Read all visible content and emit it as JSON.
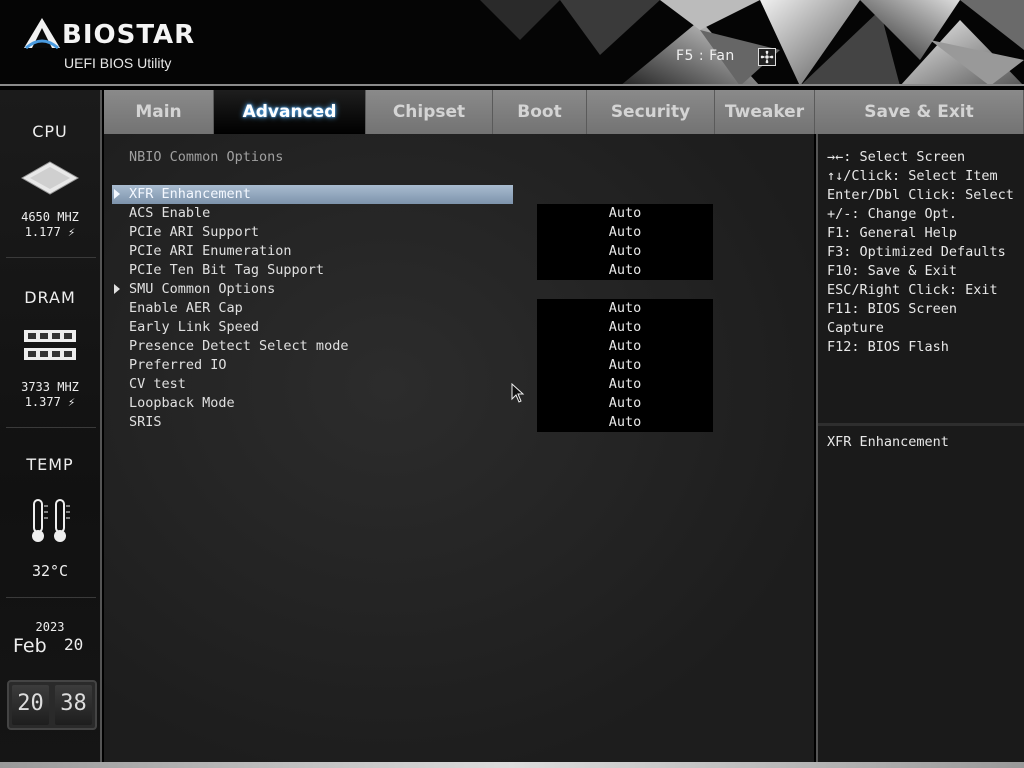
{
  "header": {
    "brand": "BIOSTAR",
    "subtitle": "UEFI BIOS Utility",
    "fan_hint": "F5 : Fan"
  },
  "sidebar": {
    "cpu": {
      "title": "CPU",
      "freq": "4650 MHZ",
      "volt": "1.177 ⚡"
    },
    "dram": {
      "title": "DRAM",
      "freq": "3733 MHZ",
      "volt": "1.377 ⚡"
    },
    "temp": {
      "title": "TEMP",
      "value": "32°C"
    },
    "date": {
      "year": "2023",
      "month": "Feb",
      "day": "20"
    },
    "clock": {
      "hour": "20",
      "minute": "38"
    }
  },
  "tabs": [
    {
      "label": "Main",
      "active": false
    },
    {
      "label": "Advanced",
      "active": true
    },
    {
      "label": "Chipset",
      "active": false
    },
    {
      "label": "Boot",
      "active": false
    },
    {
      "label": "Security",
      "active": false
    },
    {
      "label": "Tweaker",
      "active": false
    },
    {
      "label": "Save & Exit",
      "active": false
    }
  ],
  "main": {
    "section_title": "NBIO Common Options",
    "rows": [
      {
        "label": "XFR Enhancement",
        "value": "",
        "submenu": true,
        "selected": true
      },
      {
        "label": "ACS Enable",
        "value": "Auto"
      },
      {
        "label": "PCIe ARI Support",
        "value": "Auto"
      },
      {
        "label": "PCIe ARI Enumeration",
        "value": "Auto"
      },
      {
        "label": "PCIe Ten Bit Tag Support",
        "value": "Auto"
      },
      {
        "label": "SMU Common Options",
        "value": "",
        "submenu": true
      },
      {
        "label": "Enable AER Cap",
        "value": "Auto"
      },
      {
        "label": "Early Link Speed",
        "value": "Auto"
      },
      {
        "label": "Presence Detect Select mode",
        "value": "Auto"
      },
      {
        "label": "Preferred IO",
        "value": "Auto"
      },
      {
        "label": "CV test",
        "value": "Auto"
      },
      {
        "label": "Loopback Mode",
        "value": "Auto"
      },
      {
        "label": "SRIS",
        "value": "Auto"
      }
    ]
  },
  "help": {
    "lines": [
      "→←: Select Screen",
      "↑↓/Click: Select Item",
      "Enter/Dbl Click: Select",
      "+/-: Change Opt.",
      "F1: General Help",
      "F3: Optimized Defaults",
      "F10: Save & Exit",
      "ESC/Right Click: Exit",
      "F11: BIOS Screen",
      "Capture",
      "F12: BIOS Flash"
    ],
    "description": "XFR Enhancement"
  }
}
